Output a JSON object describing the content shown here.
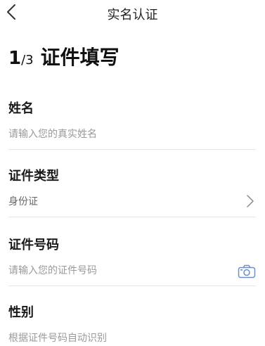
{
  "nav": {
    "title": "实名认证"
  },
  "heading": {
    "step_current": "1",
    "step_total": "3",
    "title": "证件填写"
  },
  "fields": {
    "name": {
      "label": "姓名",
      "placeholder": "请输入您的真实姓名"
    },
    "id_type": {
      "label": "证件类型",
      "value": "身份证"
    },
    "id_number": {
      "label": "证件号码",
      "placeholder": "请输入您的证件号码"
    },
    "gender": {
      "label": "性别",
      "value": "根据证件号码自动识别"
    }
  },
  "icons": {
    "back": "chevron-left-icon",
    "select": "chevron-right-icon",
    "scan": "camera-icon"
  },
  "colors": {
    "accent": "#6a8fc9",
    "placeholder": "#9a9a9a",
    "divider": "#e6e6e6"
  }
}
